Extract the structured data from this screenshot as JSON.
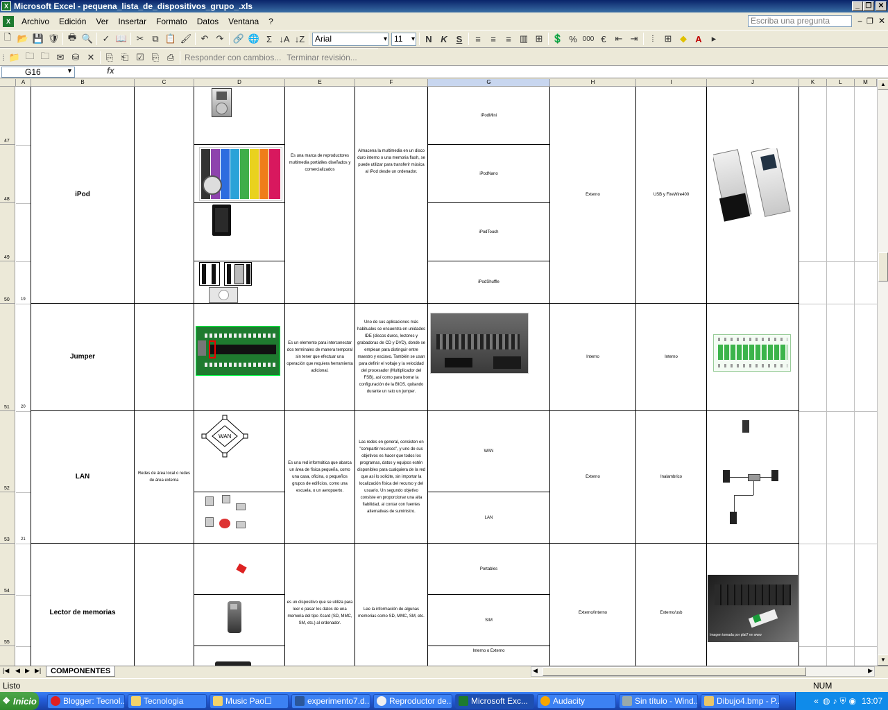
{
  "window": {
    "title": "Microsoft Excel - pequena_lista_de_dispositivos_grupo_.xls"
  },
  "menu": [
    "Archivo",
    "Edición",
    "Ver",
    "Insertar",
    "Formato",
    "Datos",
    "Ventana",
    "?"
  ],
  "ask_placeholder": "Escriba una pregunta",
  "format": {
    "font": "Arial",
    "size": "11",
    "percent": "%",
    "thousands": "000",
    "euro": "€"
  },
  "review": {
    "reply": "Responder con cambios...",
    "end": "Terminar revisión..."
  },
  "namebox": "G16",
  "fx": "fx",
  "columns": [
    "A",
    "B",
    "C",
    "D",
    "E",
    "F",
    "G",
    "H",
    "I",
    "J",
    "K",
    "L",
    "M"
  ],
  "rows": [
    "47",
    "48",
    "49",
    "50",
    "51",
    "52",
    "53",
    "54",
    "55"
  ],
  "row_index": [
    "19",
    "20",
    "21"
  ],
  "ipod": {
    "name": "iPod",
    "desc": "Es una marca de reproductores multimedia portátiles diseñados y comercializados",
    "func": "Almacena la multimedia en un disco duro interno o una memoria flash, se puede utilizar para transferir música al iPod desde un ordenador.",
    "models": [
      "iPodMini",
      "iPodNano",
      "iPodTouch",
      "iPodShuffle"
    ],
    "type": "Externo",
    "conn": "USB y FireWire400"
  },
  "jumper": {
    "name": "Jumper",
    "desc": "Es un elemento para interconectar dos terminales de manera temporal sin tener que efectuar una operación que requiera herramienta adicional.",
    "func": "Uno de sus aplicaciones más habituales se encuentra en unidades IDE (discos duros, lectores y grabadoras de CD y DVD), donde se emplean para distinguir entre maestro y esclavo. También se usan para definir el voltaje y la velocidad del procesador (Multiplicador del FSB), así como para borrar la configuración de la BIOS, quitando durante un rato un jumper.",
    "type": "Interno",
    "conn": "Interno"
  },
  "lan": {
    "name": "LAN",
    "types": "Redes de área local o redes de área externa",
    "desc": "Es una red informática que abarca un área de física pequeña, como una casa, oficina, o pequeños grupos de edificios, como una escuela, o un aeropuerto.",
    "func": "Las redes en general, consisten en \"compartir recursos\", y uno de sus objetivos es hacer que todos los programas, datos y equipos estén disponibles para cualquiera de la red que así lo solicite, sin importar la localización física del recurso y del usuario. Un segundo objetivo consiste en proporcionar una alta fiabilidad, al contar con fuentes alternativas de suministro.",
    "models": [
      "WAN",
      "LAN"
    ],
    "diagram_label": "WAN",
    "type": "Externo",
    "conn": "Inalambrico"
  },
  "reader": {
    "name": "Lector de memorias",
    "desc": "es un dispositivo que se utiliza para leer o pasar los datos de una memoria del tipo Xcard (SD, MMC, SM, etc.) al ordenador.",
    "func": "Lee la información de algunas memorias como SD, MMC, SM, etc.",
    "models": [
      "Portables",
      "SIM",
      "Interno o Externo"
    ],
    "type": "Externo/Interno",
    "conn": "Externo/usb",
    "photo_caption": "Imagen tomada por plat7 en www"
  },
  "sheet_tab": "COMPONENTES",
  "status": {
    "left": "Listo",
    "num": "NUM"
  },
  "taskbar": {
    "start": "Inicio",
    "items": [
      "Blogger: Tecnol...",
      "Tecnologia",
      "Music Pao☐",
      "experimento7.d...",
      "Reproductor de...",
      "Microsoft Exc...",
      "Audacity",
      "Sin título - Wind...",
      "Dibujo4.bmp - P..."
    ],
    "clock": "13:07"
  },
  "colors": {
    "title": "#0a246a",
    "taskbar": "#245edb",
    "start": "#2f8a2c",
    "grid_border": "#000000",
    "selected_col": "#c8d6ef"
  }
}
